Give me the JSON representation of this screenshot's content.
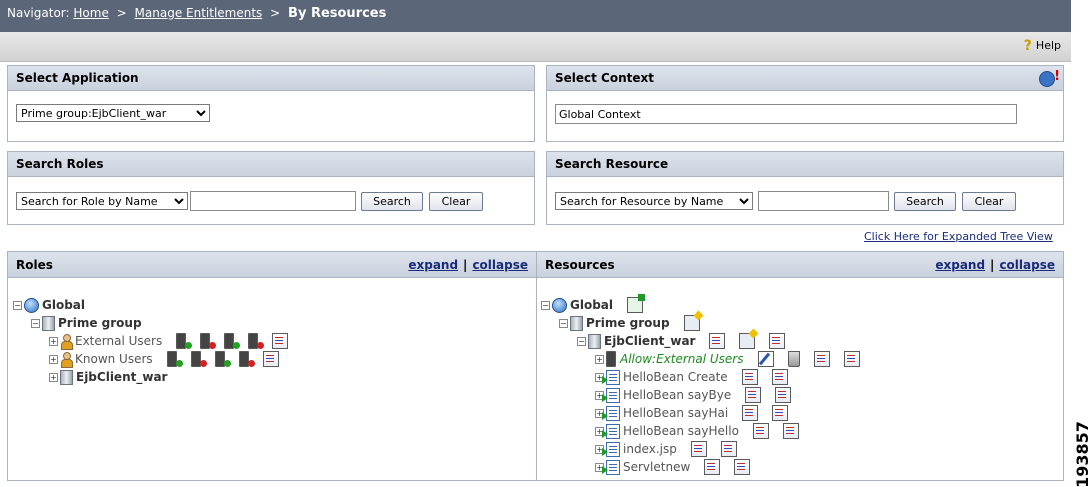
{
  "nav": {
    "prefix": "Navigator:",
    "home": "Home",
    "sep1": ">",
    "manage": "Manage Entitlements",
    "sep2": ">",
    "current": "By Resources"
  },
  "help": {
    "label": "Help"
  },
  "select_application": {
    "title": "Select Application",
    "selected": "Prime group:EjbClient_war"
  },
  "select_context": {
    "title": "Select Context",
    "value": "Global Context"
  },
  "search_roles": {
    "title": "Search Roles",
    "mode": "Search for Role by Name",
    "query": "",
    "search_label": "Search",
    "clear_label": "Clear"
  },
  "search_resource": {
    "title": "Search Resource",
    "mode": "Search for Resource by Name",
    "query": "",
    "search_label": "Search",
    "clear_label": "Clear"
  },
  "expanded_tree_link": "Click Here for Expanded Tree View",
  "roles": {
    "title": "Roles",
    "expand": "expand",
    "sep": "|",
    "collapse": "collapse",
    "tree": {
      "global": "Global",
      "group": "Prime group",
      "external_users": "External Users",
      "known_users": "Known Users",
      "app": "EjbClient_war"
    }
  },
  "resources": {
    "title": "Resources",
    "expand": "expand",
    "sep": "|",
    "collapse": "collapse",
    "tree": {
      "global": "Global",
      "group": "Prime group",
      "app": "EjbClient_war",
      "allow": "Allow:External Users",
      "items": [
        "HelloBean Create",
        "HelloBean sayBye",
        "HelloBean sayHai",
        "HelloBean sayHello",
        "index.jsp",
        "Servletnew"
      ]
    }
  },
  "figure_id": "193857"
}
